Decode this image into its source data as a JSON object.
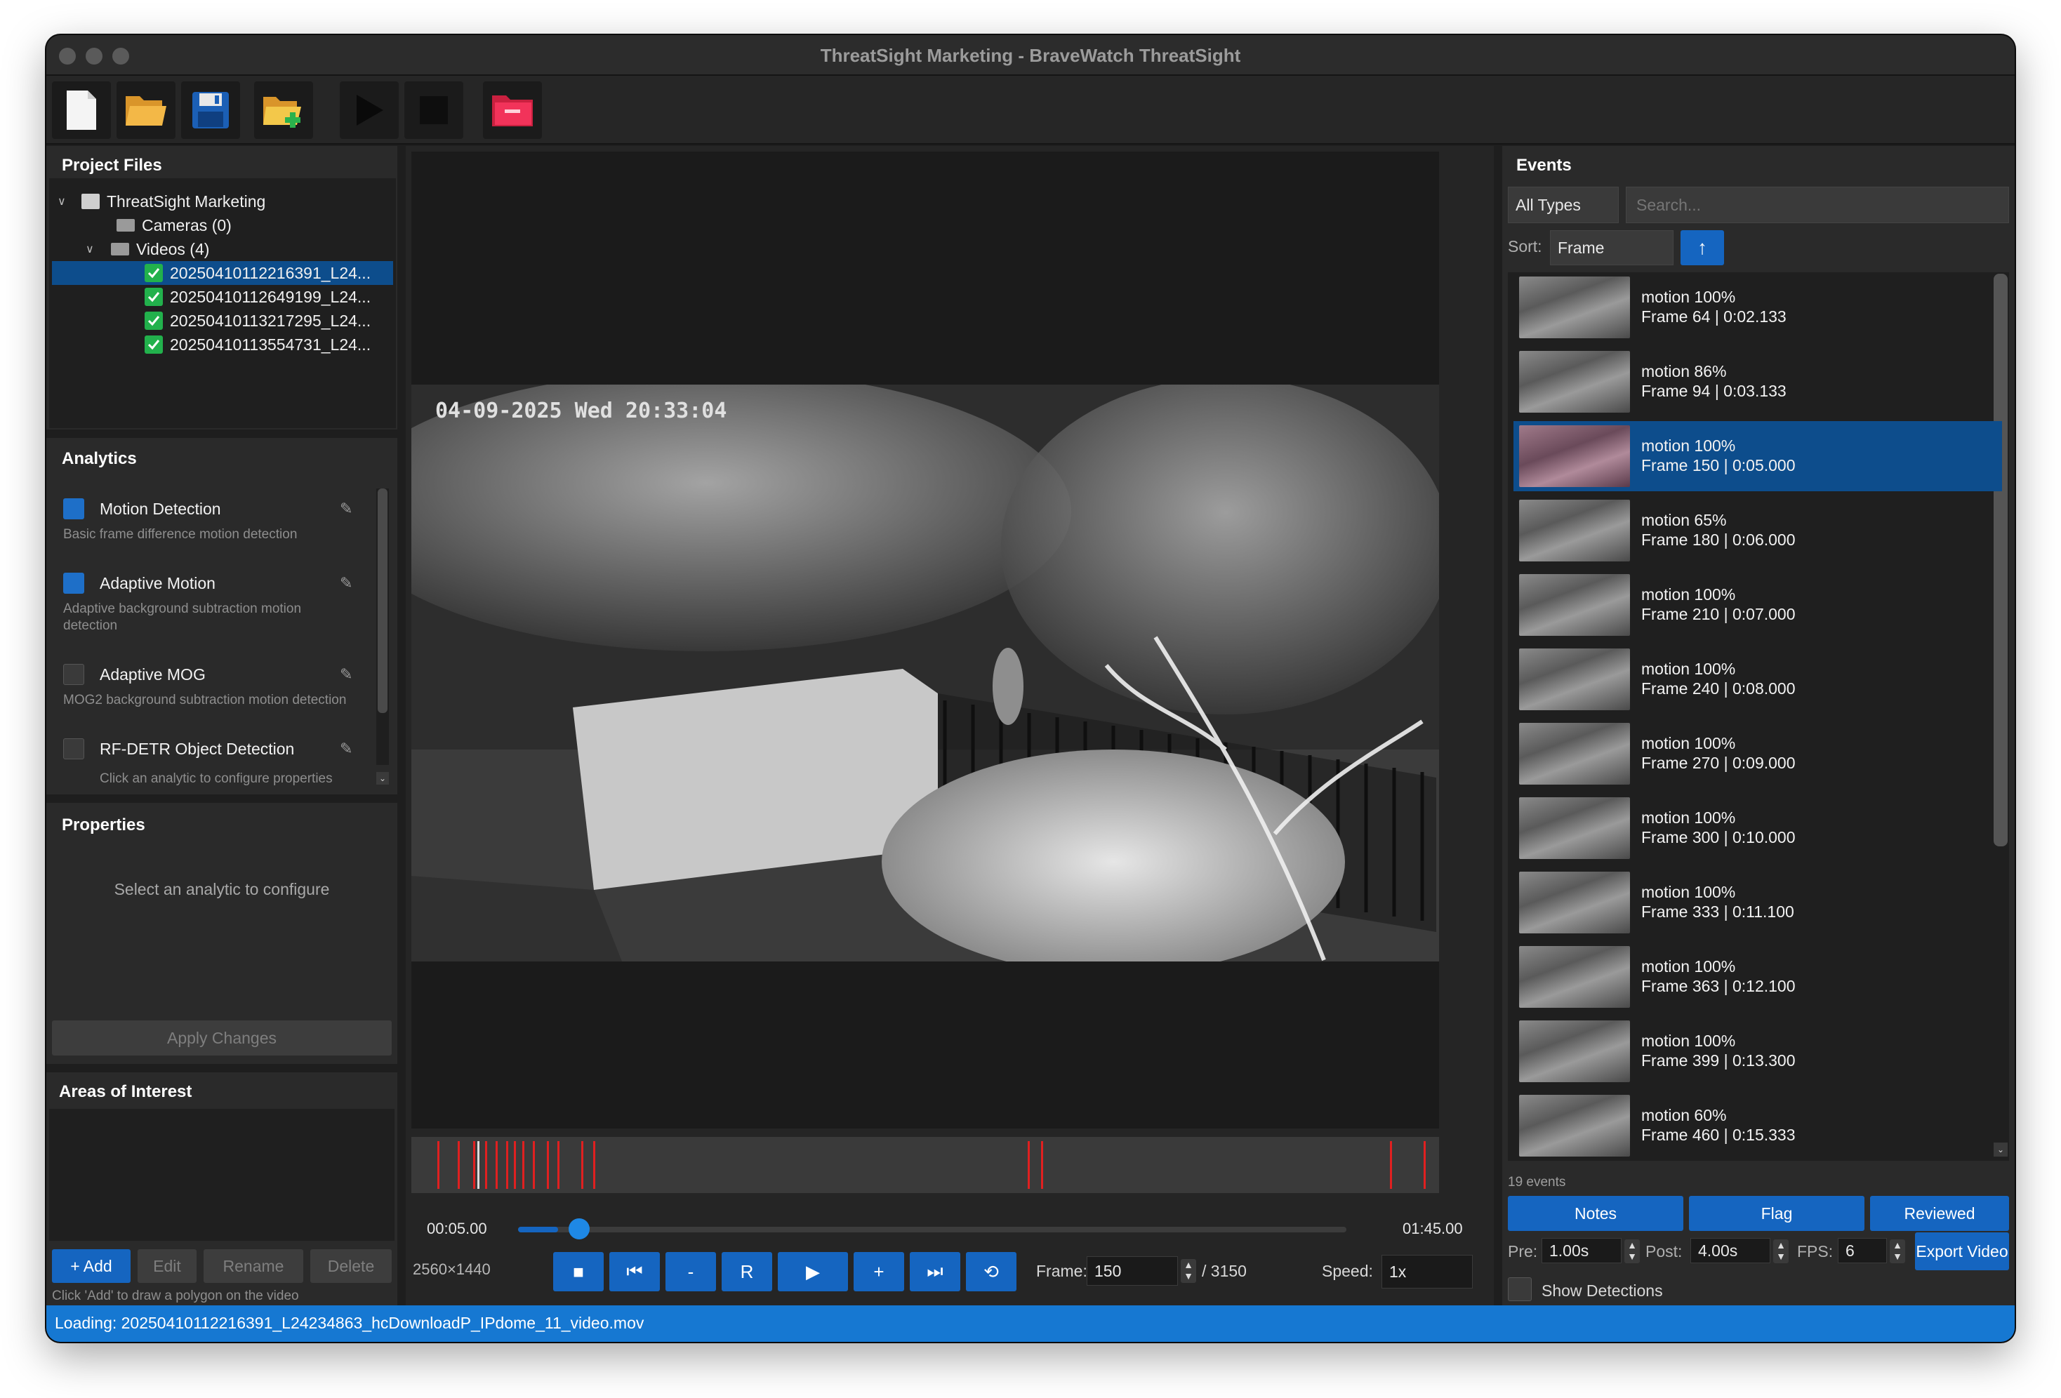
{
  "window": {
    "title": "ThreatSight Marketing - BraveWatch ThreatSight"
  },
  "toolbar": {
    "icons": [
      "new-file-icon",
      "open-folder-icon",
      "save-icon",
      "add-folder-icon",
      "play-icon",
      "stop-icon",
      "close-project-icon"
    ]
  },
  "project_files": {
    "header": "Project Files",
    "root": "ThreatSight Marketing",
    "cameras": "Cameras (0)",
    "videos": "Videos (4)",
    "files": [
      "20250410112216391_L24...",
      "20250410112649199_L24...",
      "20250410113217295_L24...",
      "20250410113554731_L24..."
    ]
  },
  "analytics": {
    "header": "Analytics",
    "items": [
      {
        "name": "Motion Detection",
        "desc": "Basic frame difference motion detection",
        "enabled": true
      },
      {
        "name": "Adaptive Motion",
        "desc": "Adaptive background subtraction motion detection",
        "enabled": true
      },
      {
        "name": "Adaptive MOG",
        "desc": "MOG2 background subtraction motion detection",
        "enabled": false
      },
      {
        "name": "RF-DETR Object Detection",
        "desc": "",
        "enabled": false
      }
    ],
    "hint": "Click an analytic to configure properties"
  },
  "properties": {
    "header": "Properties",
    "empty_text": "Select an analytic to configure",
    "apply_label": "Apply Changes"
  },
  "areas": {
    "header": "Areas of Interest",
    "add": "+ Add",
    "edit": "Edit",
    "rename": "Rename",
    "delete": "Delete",
    "hint": "Click 'Add' to draw a polygon on the video"
  },
  "video": {
    "overlay_timestamp": "04-09-2025 Wed 20:33:04",
    "resolution": "2560×1440"
  },
  "playback": {
    "current_time": "00:05.00",
    "total_time": "01:45.00",
    "progress": 0.048,
    "frame_label": "Frame:",
    "frame_value": "150",
    "frame_total": "/ 3150",
    "speed_label": "Speed:",
    "speed_value": "1x",
    "buttons": [
      "■",
      "⏮",
      "-",
      "R",
      "▶",
      "+",
      "⏭",
      "⟲"
    ]
  },
  "timeline_markers": [
    0.025,
    0.045,
    0.06,
    0.072,
    0.082,
    0.092,
    0.1,
    0.108,
    0.118,
    0.132,
    0.142,
    0.165,
    0.177,
    0.6,
    0.613,
    0.952,
    0.985
  ],
  "events": {
    "header": "Events",
    "filter": "All Types",
    "search_placeholder": "Search...",
    "sort_label": "Sort:",
    "sort_value": "Frame",
    "sort_dir": "↑",
    "count": "19 events",
    "items": [
      {
        "t1": "motion 100%",
        "t2": "Frame 64 | 0:02.133"
      },
      {
        "t1": "motion 86%",
        "t2": "Frame 94 | 0:03.133"
      },
      {
        "t1": "motion 100%",
        "t2": "Frame 150 | 0:05.000",
        "selected": true
      },
      {
        "t1": "motion 65%",
        "t2": "Frame 180 | 0:06.000"
      },
      {
        "t1": "motion 100%",
        "t2": "Frame 210 | 0:07.000"
      },
      {
        "t1": "motion 100%",
        "t2": "Frame 240 | 0:08.000"
      },
      {
        "t1": "motion 100%",
        "t2": "Frame 270 | 0:09.000"
      },
      {
        "t1": "motion 100%",
        "t2": "Frame 300 | 0:10.000"
      },
      {
        "t1": "motion 100%",
        "t2": "Frame 333 | 0:11.100"
      },
      {
        "t1": "motion 100%",
        "t2": "Frame 363 | 0:12.100"
      },
      {
        "t1": "motion 100%",
        "t2": "Frame 399 | 0:13.300"
      },
      {
        "t1": "motion 60%",
        "t2": "Frame 460 | 0:15.333"
      }
    ],
    "notes": "Notes",
    "flag": "Flag",
    "reviewed": "Reviewed",
    "pre_label": "Pre:",
    "pre_value": "1.00s",
    "post_label": "Post:",
    "post_value": "4.00s",
    "fps_label": "FPS:",
    "fps_value": "6",
    "export": "Export Video",
    "show_detections": "Show Detections"
  },
  "status": {
    "text": "Loading: 20250410112216391_L24234863_hcDownloadP_IPdome_11_video.mov"
  },
  "colors": {
    "accent": "#1565c0",
    "marker": "#e02020",
    "bg": "#1e1e1e"
  }
}
